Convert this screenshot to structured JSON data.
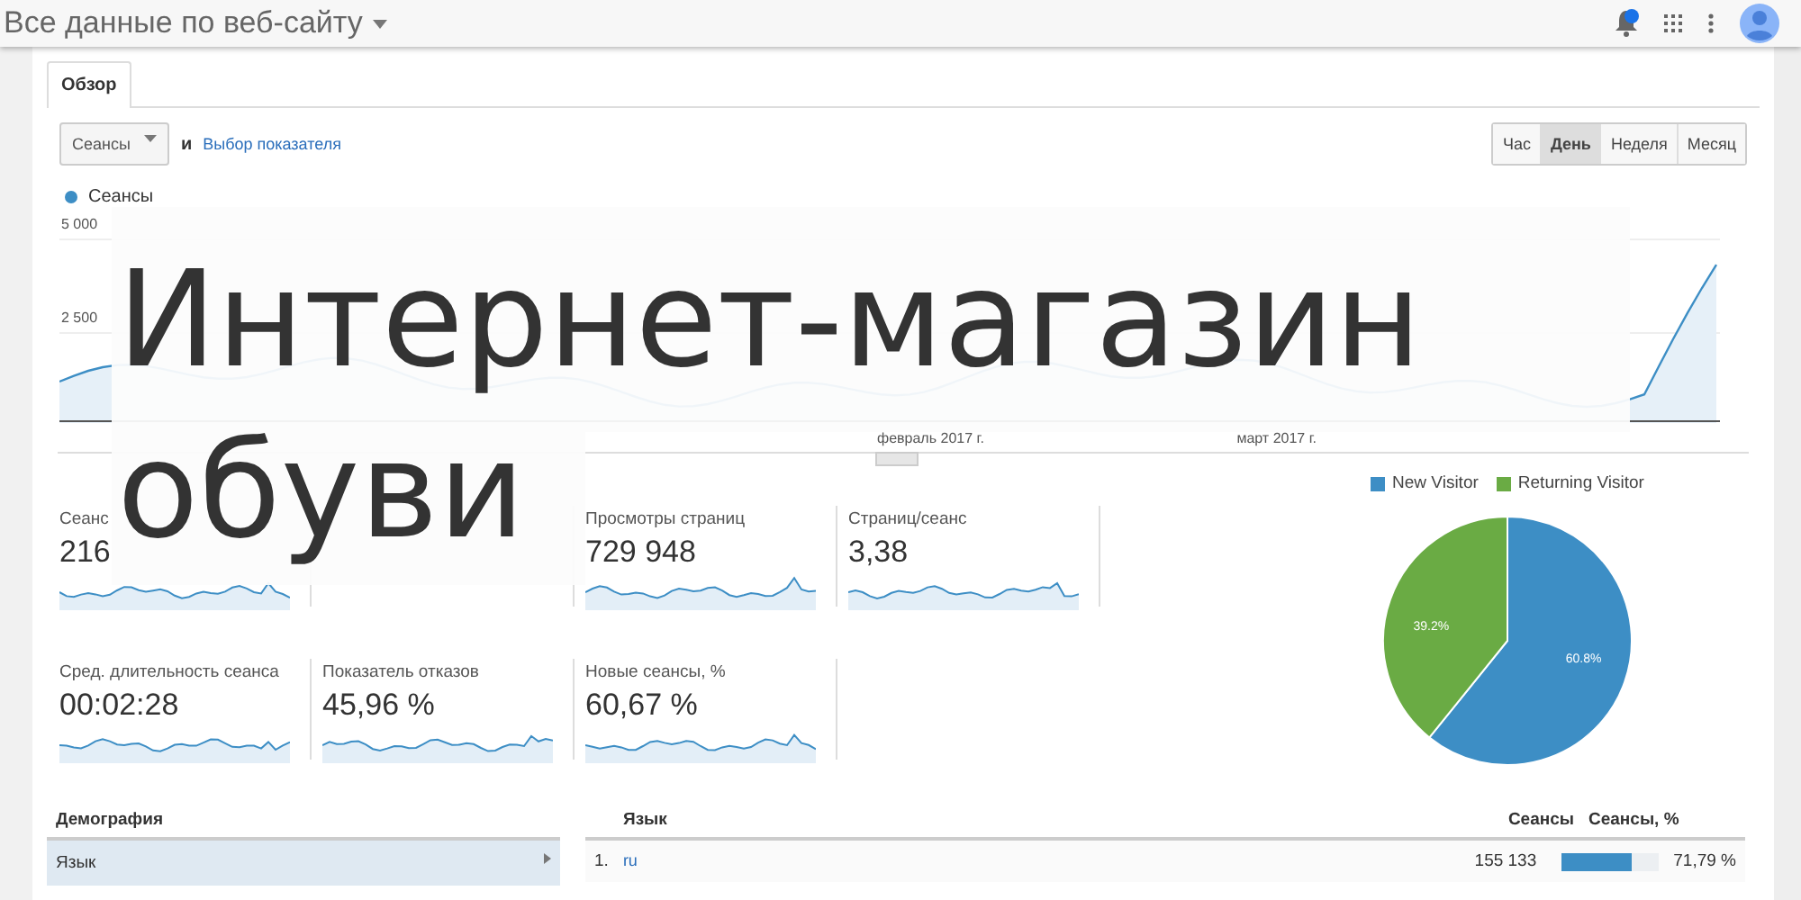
{
  "header": {
    "title": "Все данные по веб-сайту"
  },
  "tabs": [
    {
      "label": "Обзор",
      "selected": true
    }
  ],
  "controls": {
    "metric": "Сеансы",
    "conjunction": "и",
    "link": "Выбор показателя"
  },
  "periods": [
    {
      "label": "Час",
      "selected": false
    },
    {
      "label": "День",
      "selected": true
    },
    {
      "label": "Неделя",
      "selected": false
    },
    {
      "label": "Месяц",
      "selected": false
    }
  ],
  "chart": {
    "legend": "Сеансы",
    "y_labels": [
      "5 000",
      "2 500"
    ],
    "x_labels": [
      "февраль 2017 г.",
      "март 2017 г."
    ]
  },
  "metrics": [
    {
      "kind": "metric",
      "label": "Сеанс",
      "value": "216"
    },
    {
      "kind": "covered"
    },
    {
      "kind": "metric",
      "label": "Просмотры страниц",
      "value": "729 948"
    },
    {
      "kind": "metric",
      "label": "Страниц/сеанс",
      "value": "3,38"
    },
    {
      "kind": "metric",
      "label": "Сред. длительность сеанса",
      "value": "00:02:28"
    },
    {
      "kind": "metric",
      "label": "Показатель отказов",
      "value": "45,96 %"
    },
    {
      "kind": "metric",
      "label": "Новые сеансы, %",
      "value": "60,67 %"
    }
  ],
  "pie": {
    "chart_data": {
      "type": "pie",
      "legend": "top",
      "categories": [
        "New Visitor",
        "Returning Visitor"
      ],
      "values": [
        60.8,
        39.2
      ],
      "colors": [
        "#3d8ec5",
        "#6aab44"
      ],
      "value_labels": [
        "60.8%",
        "39.2%"
      ]
    }
  },
  "demography": {
    "heading": "Демография",
    "items": [
      {
        "label": "Язык",
        "selected": true
      }
    ]
  },
  "language_table": {
    "columns": [
      "Язык",
      "Сеансы",
      "Сеансы, %"
    ],
    "rows": [
      {
        "index": "1.",
        "language": "ru",
        "sessions": "155 133",
        "level": 0.7179,
        "share": "71,79 %"
      }
    ]
  },
  "headline": {
    "lines": [
      "Интернет-магазин",
      "обуви"
    ]
  }
}
